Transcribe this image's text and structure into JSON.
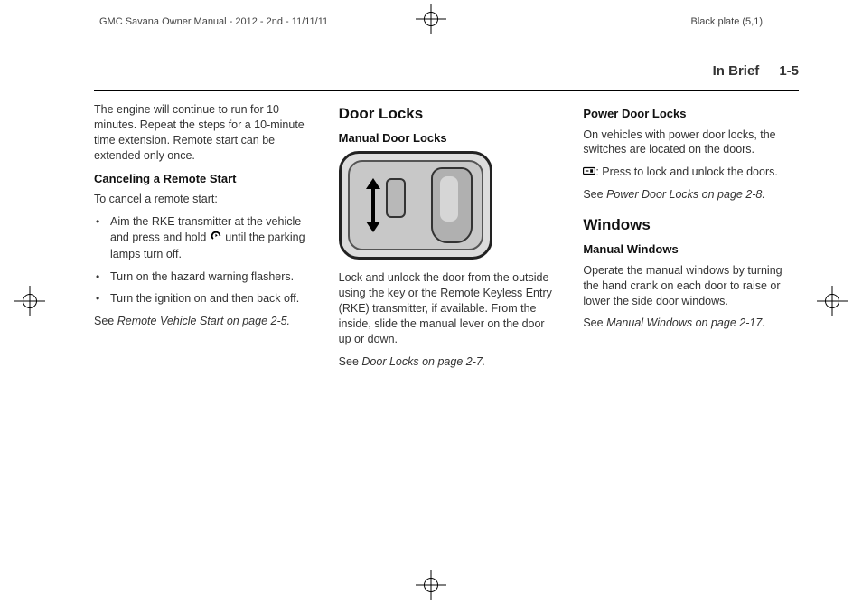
{
  "header": {
    "left": "GMC Savana Owner Manual - 2012 - 2nd - 11/11/11",
    "right": "Black plate (5,1)"
  },
  "running_head": {
    "section": "In Brief",
    "page": "1-5"
  },
  "col1": {
    "intro": "The engine will continue to run for 10 minutes. Repeat the steps for a 10-minute time extension. Remote start can be extended only once.",
    "sub1_title": "Canceling a Remote Start",
    "sub1_lead": "To cancel a remote start:",
    "bullet1a": "Aim the RKE transmitter at the vehicle and press and hold ",
    "bullet1b": " until the parking lamps turn off.",
    "bullet2": "Turn on the hazard warning flashers.",
    "bullet3": "Turn the ignition on and then back off.",
    "see_pre": "See ",
    "see_ref": "Remote Vehicle Start on page 2-5.",
    "remote_icon_name": "remote-start-icon"
  },
  "col2": {
    "h1": "Door Locks",
    "sub1_title": "Manual Door Locks",
    "illus_name": "manual-door-lock-illustration",
    "body": "Lock and unlock the door from the outside using the key or the Remote Keyless Entry (RKE) transmitter, if available. From the inside, slide the manual lever on the door up or down.",
    "see_pre": "See ",
    "see_ref": "Door Locks on page 2-7."
  },
  "col3": {
    "sub1_title": "Power Door Locks",
    "p1": "On vehicles with power door locks, the switches are located on the doors.",
    "lock_icon_name": "power-lock-icon",
    "p2_label": ":",
    "p2_text": "  Press to lock and unlock the doors.",
    "see1_pre": "See ",
    "see1_ref": "Power Door Locks on page 2-8.",
    "h1b": "Windows",
    "sub2_title": "Manual Windows",
    "p3": "Operate the manual windows by turning the hand crank on each door to raise or lower the side door windows.",
    "see2_pre": "See ",
    "see2_ref": "Manual Windows on page 2-17."
  }
}
